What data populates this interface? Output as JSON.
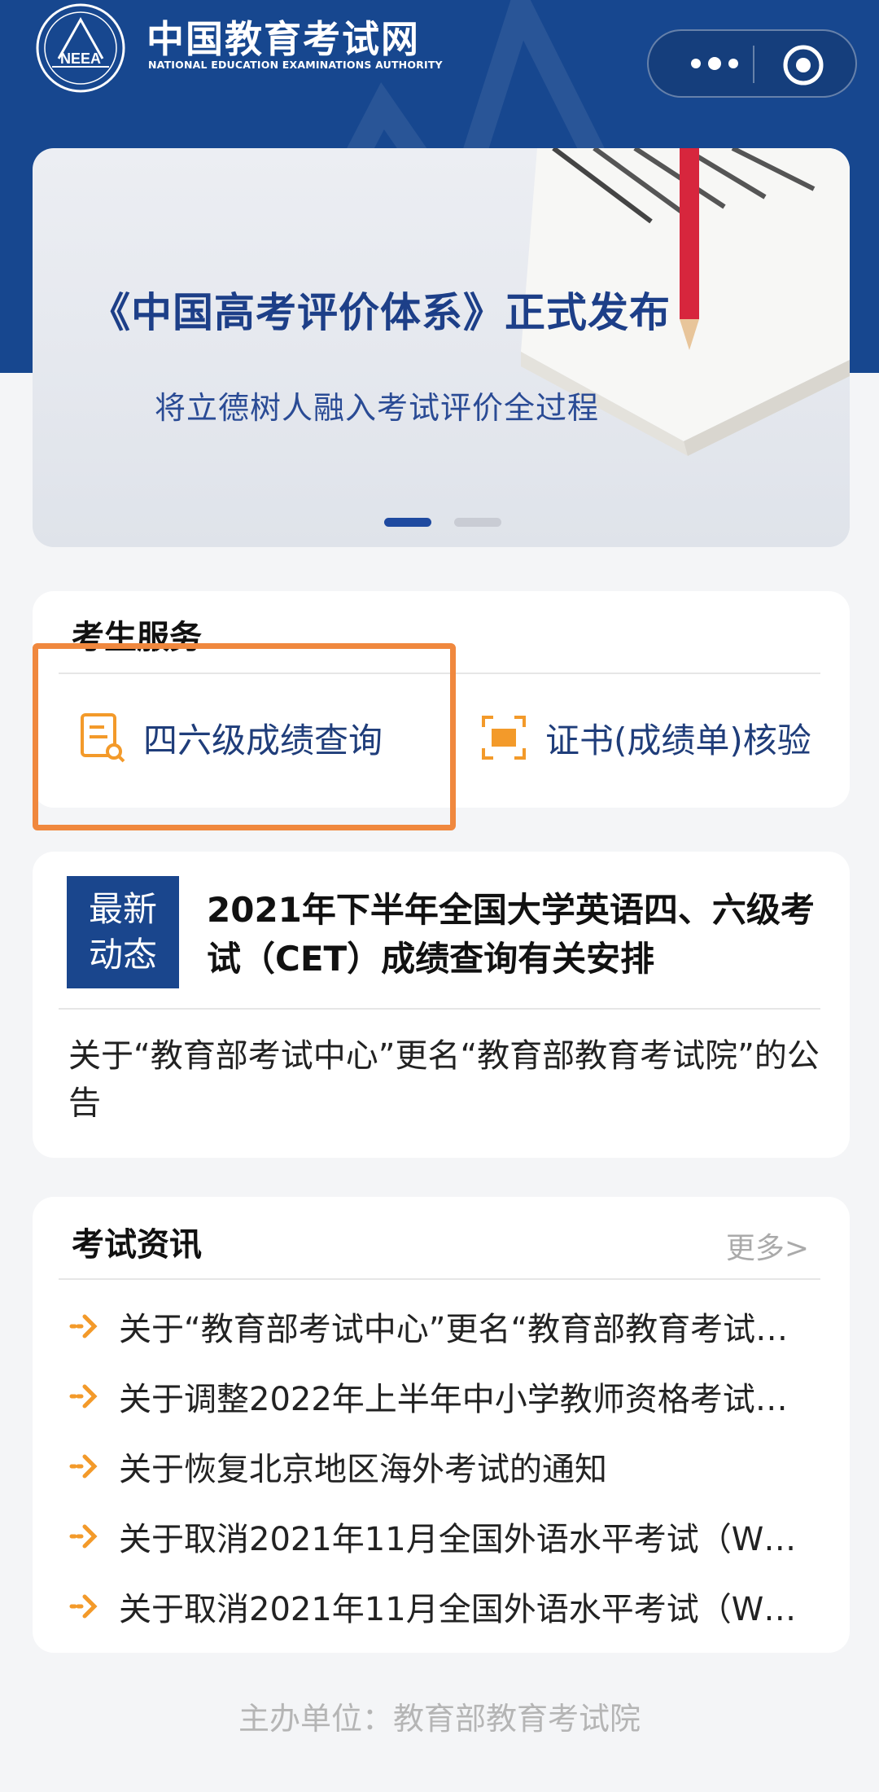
{
  "header": {
    "brand_cn": "中国教育考试网",
    "brand_en": "NATIONAL EDUCATION EXAMINATIONS AUTHORITY",
    "logo_text": "NEEA",
    "more_icon": "more-dots-icon",
    "close_icon": "target-close-icon"
  },
  "banner": {
    "title": "《中国高考评价体系》正式发布",
    "subtitle": "将立德树人融入考试评价全过程",
    "slide_count": 2,
    "active_slide": 1
  },
  "services": {
    "title": "考生服务",
    "items": [
      {
        "label": "四六级成绩查询",
        "icon": "score-query-icon"
      },
      {
        "label": "证书(成绩单)核验",
        "icon": "verify-icon"
      }
    ]
  },
  "news": {
    "badge_line1": "最新",
    "badge_line2": "动态",
    "headline": "2021年下半年全国大学英语四、六级考试（CET）成绩查询有关安排",
    "second": "关于“教育部考试中心”更名“教育部教育考试院”的公告"
  },
  "info": {
    "title": "考试资讯",
    "more": "更多>",
    "items": [
      "关于“教育部考试中心”更名“教育部教育考试…",
      "关于调整2022年上半年中小学教师资格考试…",
      "关于恢复北京地区海外考试的通知",
      "关于取消2021年11月全国外语水平考试（W…",
      "关于取消2021年11月全国外语水平考试（W…"
    ]
  },
  "footer": "主办单位：教育部教育考试院",
  "colors": {
    "brand_blue": "#17478f",
    "highlight_orange": "#f0883e",
    "icon_orange": "#f39a2a"
  }
}
